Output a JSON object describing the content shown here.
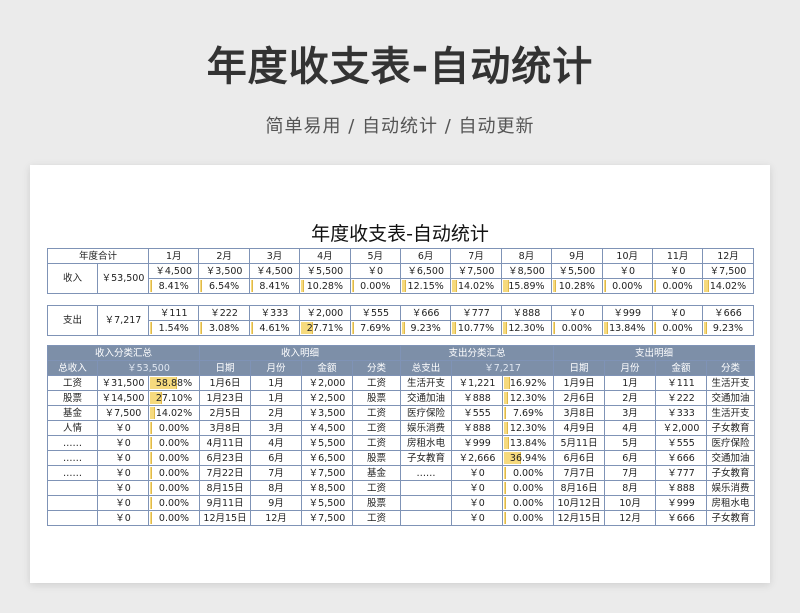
{
  "header": {
    "title": "年度收支表-自动统计",
    "subtitle": "简单易用 / 自动统计 / 自动更新"
  },
  "sheet_title": "年度收支表-自动统计",
  "year_table": {
    "corner": "年度合计",
    "months": [
      "1月",
      "2月",
      "3月",
      "4月",
      "5月",
      "6月",
      "7月",
      "8月",
      "9月",
      "10月",
      "11月",
      "12月"
    ],
    "income": {
      "label": "收入",
      "total": "￥53,500",
      "amounts": [
        "￥4,500",
        "￥3,500",
        "￥4,500",
        "￥5,500",
        "￥0",
        "￥6,500",
        "￥7,500",
        "￥8,500",
        "￥5,500",
        "￥0",
        "￥0",
        "￥7,500"
      ],
      "pcts": [
        "8.41%",
        "6.54%",
        "8.41%",
        "10.28%",
        "0.00%",
        "12.15%",
        "14.02%",
        "15.89%",
        "10.28%",
        "0.00%",
        "0.00%",
        "14.02%"
      ],
      "fractions": [
        0.0841,
        0.0654,
        0.0841,
        0.1028,
        0,
        0.1215,
        0.1402,
        0.1589,
        0.1028,
        0,
        0,
        0.1402
      ]
    },
    "expense": {
      "label": "支出",
      "total": "￥7,217",
      "amounts": [
        "￥111",
        "￥222",
        "￥333",
        "￥2,000",
        "￥555",
        "￥666",
        "￥777",
        "￥888",
        "￥0",
        "￥999",
        "￥0",
        "￥666"
      ],
      "pcts": [
        "1.54%",
        "3.08%",
        "4.61%",
        "27.71%",
        "7.69%",
        "9.23%",
        "10.77%",
        "12.30%",
        "0.00%",
        "13.84%",
        "0.00%",
        "9.23%"
      ],
      "fractions": [
        0.0154,
        0.0308,
        0.0461,
        0.2771,
        0.0769,
        0.0923,
        0.1077,
        0.123,
        0,
        0.1384,
        0,
        0.0923
      ]
    }
  },
  "detail": {
    "section_headers": [
      "收入分类汇总",
      "收入明细",
      "支出分类汇总",
      "支出明细"
    ],
    "sub_headers": {
      "income_total_label": "总收入",
      "income_total": "￥53,500",
      "income_cols": [
        "日期",
        "月份",
        "金额",
        "分类"
      ],
      "expense_total_label": "总支出",
      "expense_total": "￥7,217",
      "expense_cols": [
        "日期",
        "月份",
        "金额",
        "分类"
      ]
    },
    "rows": [
      {
        "ic": "工资",
        "ia": "￥31,500",
        "ip": "58.88%",
        "if": 0.5888,
        "d": "1月6日",
        "m": "1月",
        "a": "￥2,000",
        "c": "工资",
        "ec": "生活开支",
        "ea": "￥1,221",
        "ep": "16.92%",
        "ef": 0.1692,
        "ed": "1月9日",
        "em": "1月",
        "eam": "￥111",
        "ecat": "生活开支"
      },
      {
        "ic": "股票",
        "ia": "￥14,500",
        "ip": "27.10%",
        "if": 0.271,
        "d": "1月23日",
        "m": "1月",
        "a": "￥2,500",
        "c": "股票",
        "ec": "交通加油",
        "ea": "￥888",
        "ep": "12.30%",
        "ef": 0.123,
        "ed": "2月6日",
        "em": "2月",
        "eam": "￥222",
        "ecat": "交通加油"
      },
      {
        "ic": "基金",
        "ia": "￥7,500",
        "ip": "14.02%",
        "if": 0.1402,
        "d": "2月5日",
        "m": "2月",
        "a": "￥3,500",
        "c": "工资",
        "ec": "医疗保险",
        "ea": "￥555",
        "ep": "7.69%",
        "ef": 0.0769,
        "ed": "3月8日",
        "em": "3月",
        "eam": "￥333",
        "ecat": "生活开支"
      },
      {
        "ic": "人情",
        "ia": "￥0",
        "ip": "0.00%",
        "if": 0,
        "d": "3月8日",
        "m": "3月",
        "a": "￥4,500",
        "c": "工资",
        "ec": "娱乐消费",
        "ea": "￥888",
        "ep": "12.30%",
        "ef": 0.123,
        "ed": "4月9日",
        "em": "4月",
        "eam": "￥2,000",
        "ecat": "子女教育"
      },
      {
        "ic": "……",
        "ia": "￥0",
        "ip": "0.00%",
        "if": 0,
        "d": "4月11日",
        "m": "4月",
        "a": "￥5,500",
        "c": "工资",
        "ec": "房租水电",
        "ea": "￥999",
        "ep": "13.84%",
        "ef": 0.1384,
        "ed": "5月11日",
        "em": "5月",
        "eam": "￥555",
        "ecat": "医疗保险"
      },
      {
        "ic": "……",
        "ia": "￥0",
        "ip": "0.00%",
        "if": 0,
        "d": "6月23日",
        "m": "6月",
        "a": "￥6,500",
        "c": "股票",
        "ec": "子女教育",
        "ea": "￥2,666",
        "ep": "36.94%",
        "ef": 0.3694,
        "ed": "6月6日",
        "em": "6月",
        "eam": "￥666",
        "ecat": "交通加油"
      },
      {
        "ic": "……",
        "ia": "￥0",
        "ip": "0.00%",
        "if": 0,
        "d": "7月22日",
        "m": "7月",
        "a": "￥7,500",
        "c": "基金",
        "ec": "……",
        "ea": "￥0",
        "ep": "0.00%",
        "ef": 0,
        "ed": "7月7日",
        "em": "7月",
        "eam": "￥777",
        "ecat": "子女教育"
      },
      {
        "ic": "",
        "ia": "￥0",
        "ip": "0.00%",
        "if": 0,
        "d": "8月15日",
        "m": "8月",
        "a": "￥8,500",
        "c": "工资",
        "ec": "",
        "ea": "￥0",
        "ep": "0.00%",
        "ef": 0,
        "ed": "8月16日",
        "em": "8月",
        "eam": "￥888",
        "ecat": "娱乐消费"
      },
      {
        "ic": "",
        "ia": "￥0",
        "ip": "0.00%",
        "if": 0,
        "d": "9月11日",
        "m": "9月",
        "a": "￥5,500",
        "c": "股票",
        "ec": "",
        "ea": "￥0",
        "ep": "0.00%",
        "ef": 0,
        "ed": "10月12日",
        "em": "10月",
        "eam": "￥999",
        "ecat": "房租水电"
      },
      {
        "ic": "",
        "ia": "￥0",
        "ip": "0.00%",
        "if": 0,
        "d": "12月15日",
        "m": "12月",
        "a": "￥7,500",
        "c": "工资",
        "ec": "",
        "ea": "￥0",
        "ep": "0.00%",
        "ef": 0,
        "ed": "12月15日",
        "em": "12月",
        "eam": "￥666",
        "ecat": "子女教育"
      }
    ]
  }
}
